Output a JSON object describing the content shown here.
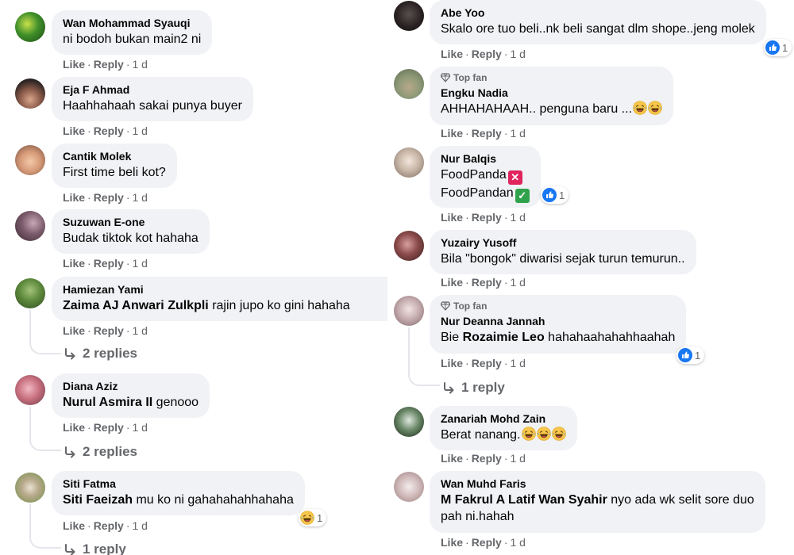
{
  "labels": {
    "like": "Like",
    "reply": "Reply",
    "dot": "·",
    "top_fan": "Top fan"
  },
  "left": [
    {
      "name": "Wan Mohammad Syauqi",
      "text": "ni bodoh bukan main2 ni",
      "time": "1 d"
    },
    {
      "name": "Eja F Ahmad",
      "text": "Haahhahaah sakai punya buyer",
      "time": "1 d"
    },
    {
      "name": "Cantik Molek",
      "text": "First time beli kot?",
      "time": "1 d"
    },
    {
      "name": "Suzuwan E-one",
      "text": "Budak tiktok kot hahaha",
      "time": "1 d"
    },
    {
      "name": "Hamiezan Yami",
      "mention": "Zaima AJ Anwari Zulkpli",
      "text": " rajin jupo ko gini hahaha",
      "time": "1 d",
      "replies": "2 replies"
    },
    {
      "name": "Diana Aziz",
      "mention": "Nurul Asmira II",
      "text": " genooo",
      "time": "1 d",
      "replies": "2 replies"
    },
    {
      "name": "Siti Fatma",
      "mention": "Siti Faeizah",
      "text": " mu ko ni gahahahahhahaha",
      "time": "1 d",
      "replies": "1 reply",
      "reaction_count": "1"
    }
  ],
  "right": [
    {
      "name": "Abe Yoo",
      "text": "Skalo ore tuo beli..nk beli sangat dlm shope..jeng molek",
      "time": "1 d",
      "reaction_count": "1"
    },
    {
      "name": "Engku Nadia",
      "text": "AHHAHAHAAH.. penguna baru ...",
      "time": "1 d"
    },
    {
      "name": "Nur Balqis",
      "text_line1": "FoodPanda",
      "text_line2": "FoodPandan",
      "time": "1 d",
      "reaction_count": "1"
    },
    {
      "name": "Yuzairy Yusoff",
      "text": "Bila \"bongok\" diwarisi sejak turun temurun..",
      "time": "1 d"
    },
    {
      "name": "Nur Deanna Jannah",
      "prefix": "Bie ",
      "mention": "Rozaimie Leo",
      "text": " hahahaahahahhaahah",
      "time": "1 d",
      "replies": "1 reply",
      "reaction_count": "1"
    },
    {
      "name": "Zanariah Mohd Zain",
      "text": "Berat nanang.",
      "time": "1 d"
    },
    {
      "name": "Wan Muhd Faris",
      "mention": "M Fakrul A Latif Wan Syahir",
      "text": " nyo ada wk selit sore duo",
      "text_line2": "pah ni.hahah",
      "time": "1 d"
    }
  ],
  "colors": {
    "bubble": "#f0f2f5",
    "meta": "#65676b",
    "like_blue": "#1877f2"
  }
}
